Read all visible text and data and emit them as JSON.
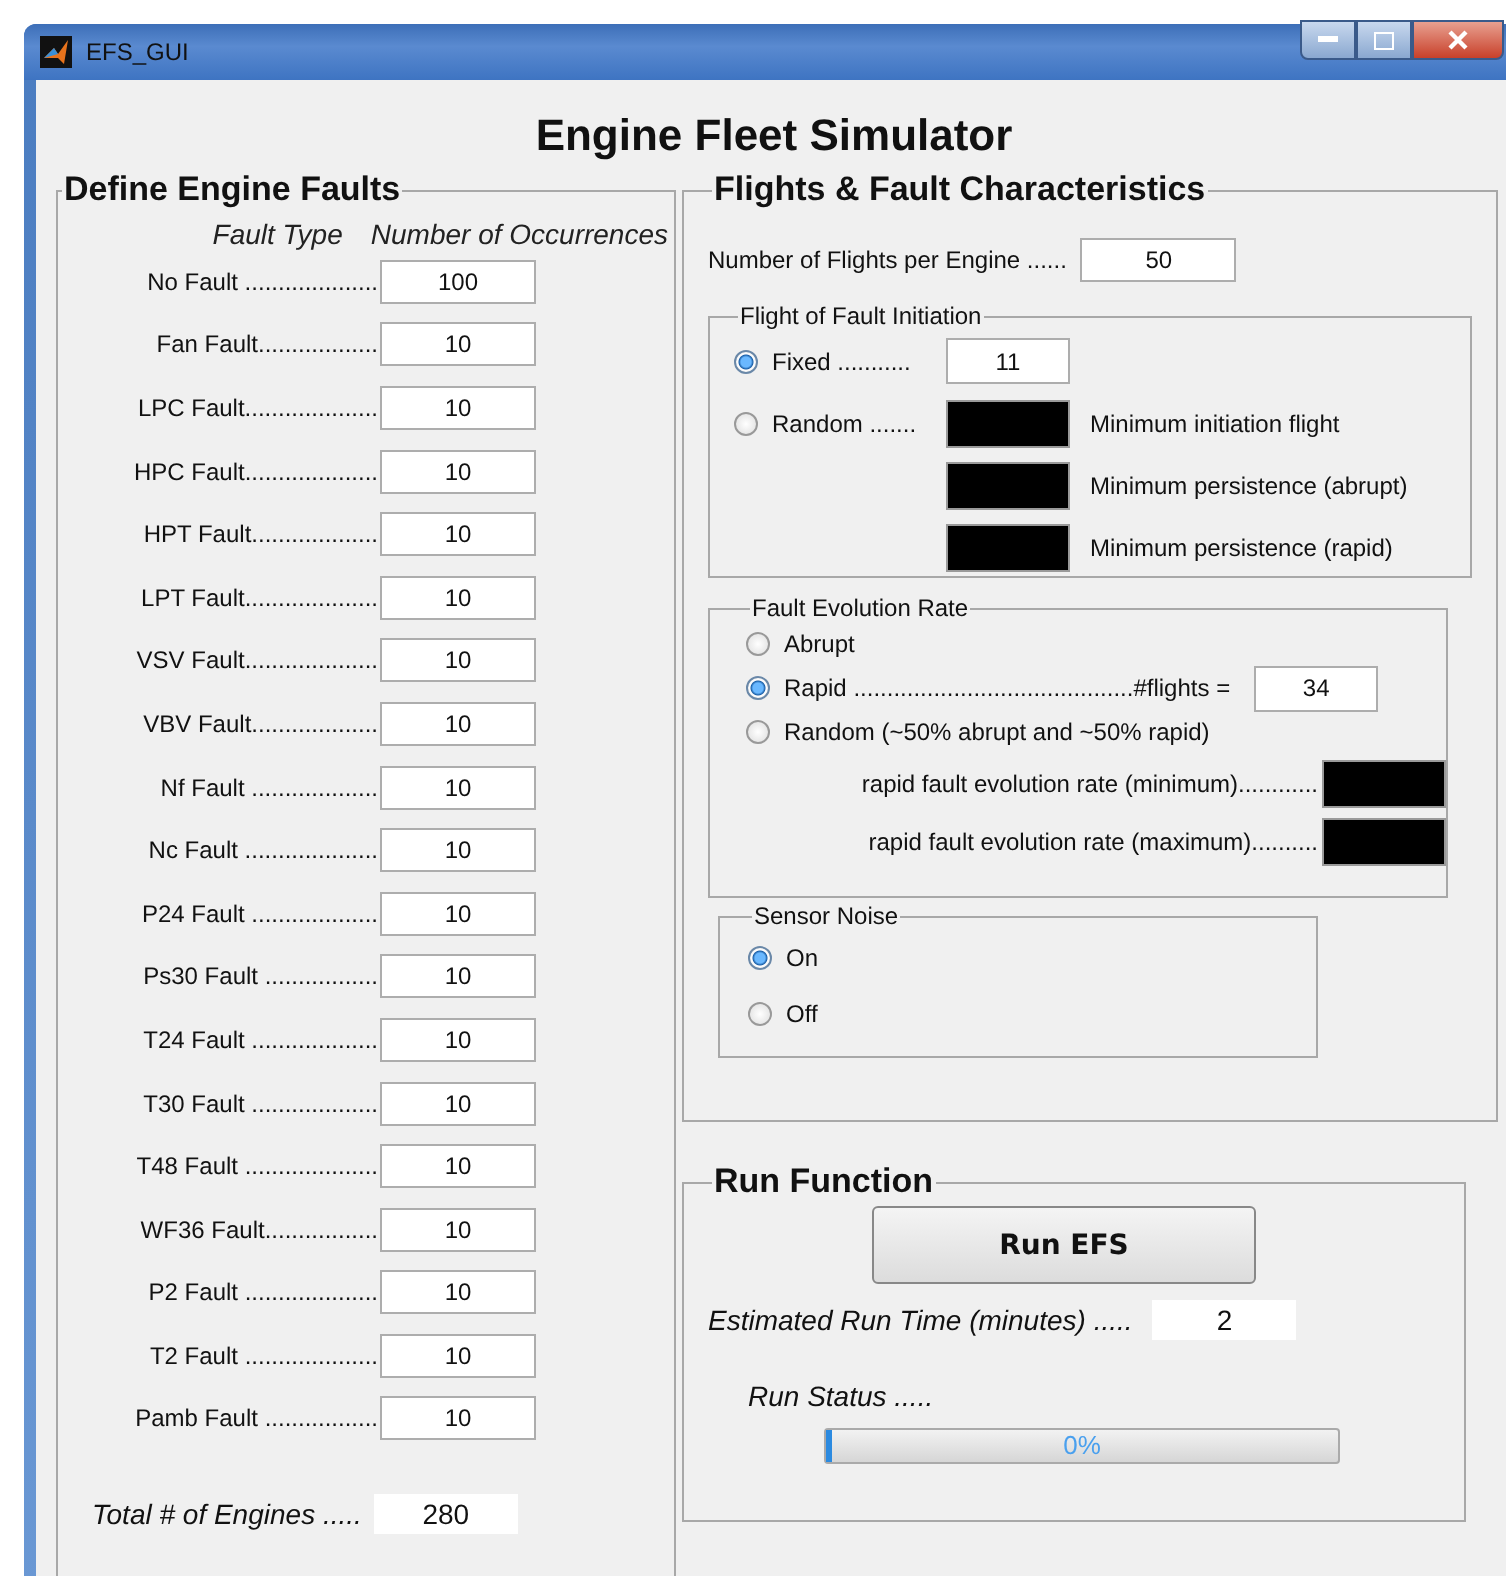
{
  "window": {
    "title": "EFS_GUI"
  },
  "heading": "Engine Fleet Simulator",
  "faults": {
    "title": "Define Engine Faults",
    "col_type": "Fault Type",
    "col_count": "Number of Occurrences",
    "rows": [
      {
        "label": "No Fault ....................",
        "value": "100"
      },
      {
        "label": "Fan Fault..................",
        "value": "10"
      },
      {
        "label": "LPC Fault....................",
        "value": "10"
      },
      {
        "label": "HPC Fault....................",
        "value": "10"
      },
      {
        "label": "HPT Fault...................",
        "value": "10"
      },
      {
        "label": "LPT Fault....................",
        "value": "10"
      },
      {
        "label": "VSV Fault....................",
        "value": "10"
      },
      {
        "label": "VBV Fault...................",
        "value": "10"
      },
      {
        "label": "Nf Fault ...................",
        "value": "10"
      },
      {
        "label": "Nc Fault ....................",
        "value": "10"
      },
      {
        "label": "P24 Fault ...................",
        "value": "10"
      },
      {
        "label": "Ps30 Fault .................",
        "value": "10"
      },
      {
        "label": "T24 Fault ...................",
        "value": "10"
      },
      {
        "label": "T30 Fault ...................",
        "value": "10"
      },
      {
        "label": "T48 Fault ....................",
        "value": "10"
      },
      {
        "label": "WF36 Fault.................",
        "value": "10"
      },
      {
        "label": "P2 Fault ....................",
        "value": "10"
      },
      {
        "label": "T2 Fault ....................",
        "value": "10"
      },
      {
        "label": "Pamb Fault .................",
        "value": "10"
      }
    ],
    "total_label": "Total # of Engines .....",
    "total": "280"
  },
  "flights": {
    "title": "Flights & Fault Characteristics",
    "per_engine_label": "Number of Flights per Engine ......",
    "per_engine": "50",
    "initiation": {
      "title": "Flight of Fault Initiation",
      "options": [
        {
          "label": "Fixed ...........",
          "selected": true,
          "value": "11"
        },
        {
          "label": "Random .......",
          "selected": false
        }
      ],
      "random_fields": [
        "Minimum initiation flight",
        "Minimum persistence (abrupt)",
        "Minimum persistence (rapid)"
      ]
    },
    "evolution": {
      "title": "Fault Evolution Rate",
      "options": [
        {
          "label": "Abrupt",
          "selected": false
        },
        {
          "label": "Rapid ..........................................#flights =",
          "selected": true,
          "value": "34"
        },
        {
          "label": "Random (~50% abrupt and ~50% rapid)",
          "selected": false
        }
      ],
      "rate_fields": [
        "rapid fault evolution rate (minimum)............",
        "rapid fault evolution rate (maximum).........."
      ]
    },
    "noise": {
      "title": "Sensor Noise",
      "options": [
        {
          "label": "On",
          "selected": true
        },
        {
          "label": "Off",
          "selected": false
        }
      ]
    }
  },
  "run": {
    "title": "Run Function",
    "button": "Run EFS",
    "time_label": "Estimated Run Time (minutes) .....",
    "time": "2",
    "status_label": "Run Status .....",
    "progress": {
      "level": 0,
      "text": "0%"
    }
  }
}
